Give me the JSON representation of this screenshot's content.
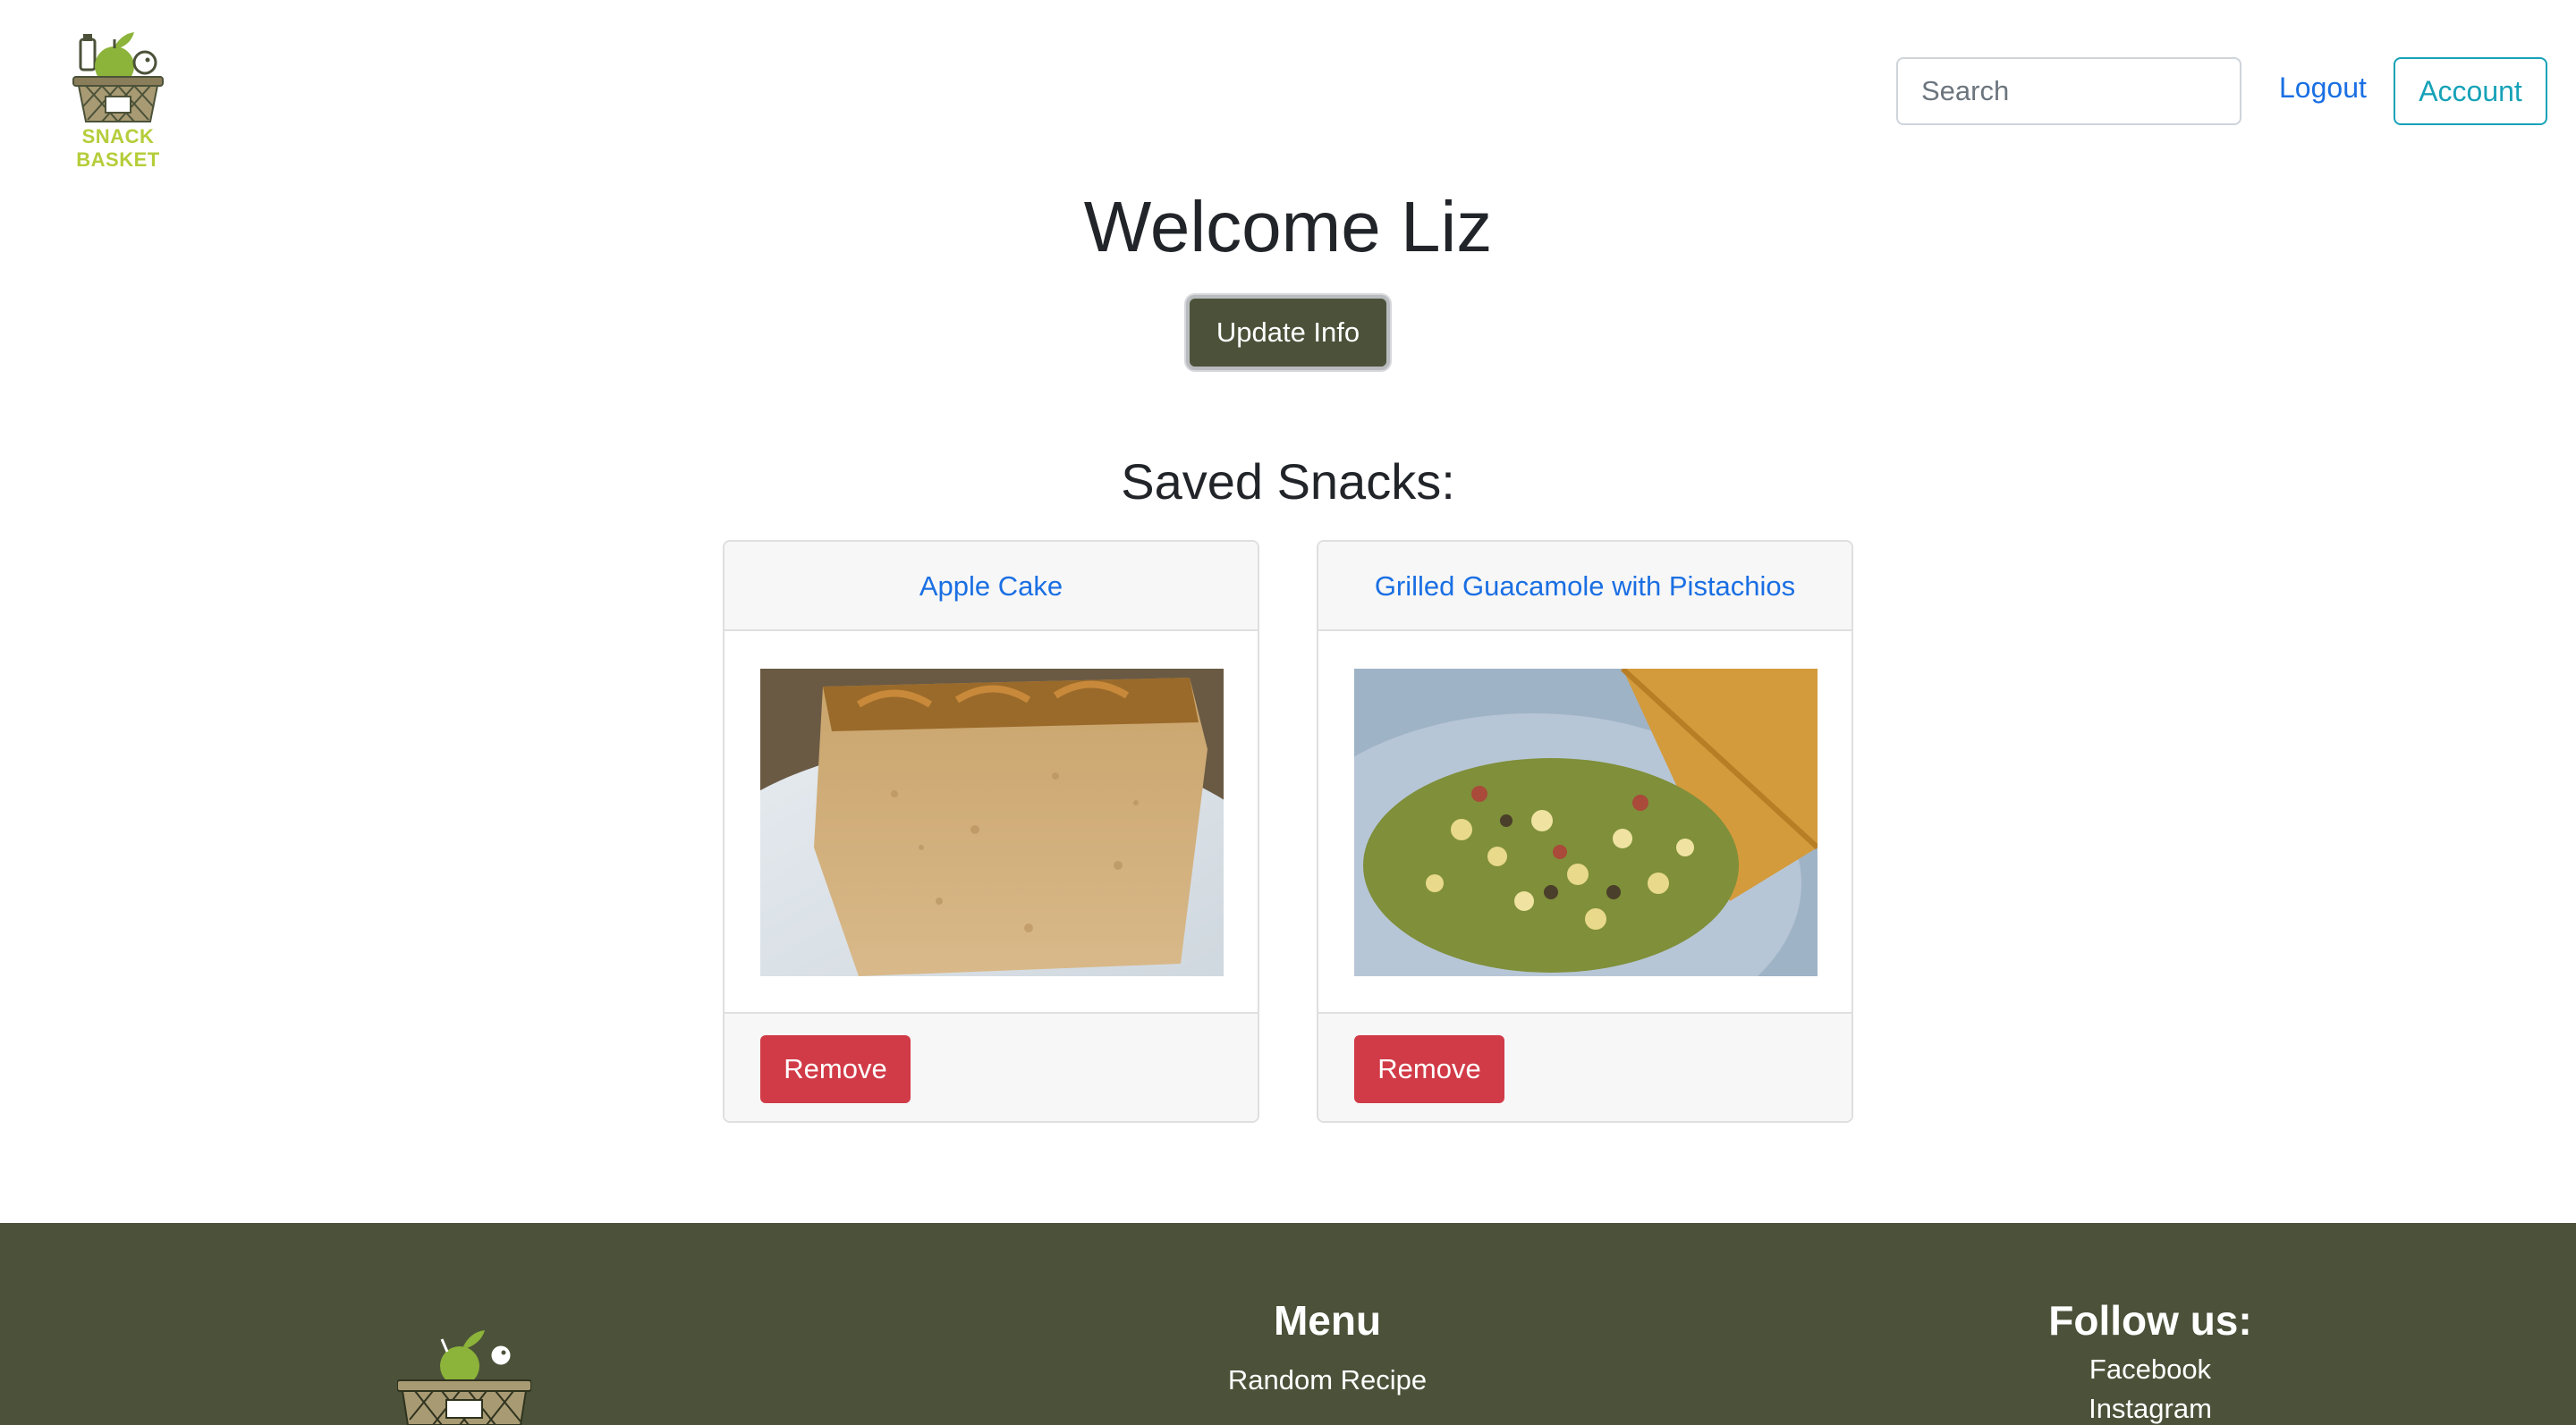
{
  "brand": {
    "name": "SNACK BASKET",
    "color": "#b5cd3a"
  },
  "nav": {
    "search_placeholder": "Search",
    "logout_label": "Logout",
    "account_label": "Account"
  },
  "main": {
    "welcome": "Welcome Liz",
    "update_label": "Update Info",
    "saved_title": "Saved Snacks:"
  },
  "snacks": [
    {
      "title": "Apple Cake",
      "remove_label": "Remove",
      "image": "apple-cake-photo"
    },
    {
      "title": "Grilled Guacamole with Pistachios",
      "remove_label": "Remove",
      "image": "guacamole-photo"
    }
  ],
  "footer": {
    "menu_title": "Menu",
    "menu_items": [
      "Random Recipe"
    ],
    "follow_title": "Follow us:",
    "follow_items": [
      "Facebook",
      "Instagram"
    ]
  },
  "colors": {
    "primary_link": "#1a6fe3",
    "account_teal": "#17a2b8",
    "olive": "#4b5239",
    "danger": "#d13b47"
  }
}
